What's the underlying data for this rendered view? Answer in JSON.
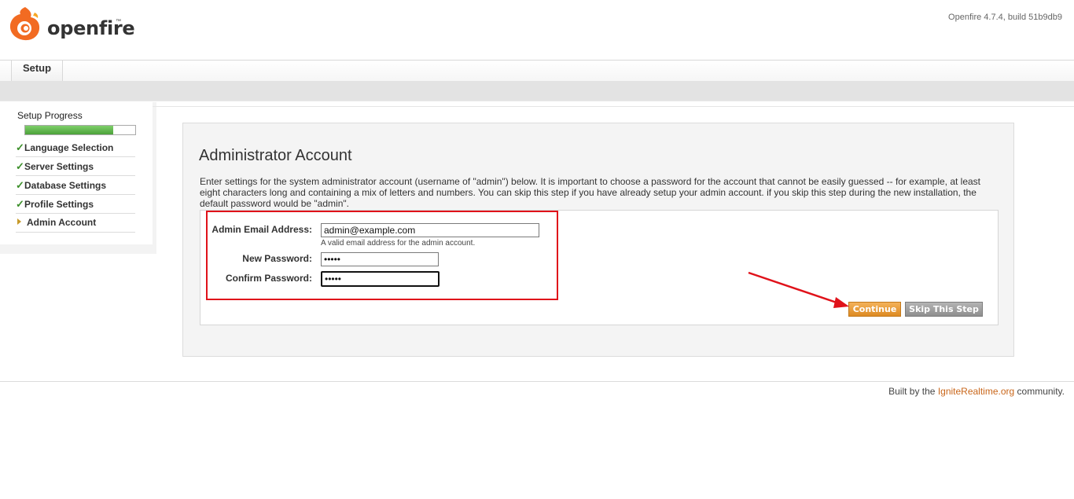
{
  "header": {
    "logo_text": "openfire",
    "logo_tm": "™",
    "version": "Openfire 4.7.4, build 51b9db9"
  },
  "tabs": [
    {
      "label": "Setup"
    }
  ],
  "sidebar": {
    "progress_label": "Setup Progress",
    "progress_fraction": 0.8,
    "steps": [
      {
        "label": "Language Selection",
        "status": "complete"
      },
      {
        "label": "Server Settings",
        "status": "complete"
      },
      {
        "label": "Database Settings",
        "status": "complete"
      },
      {
        "label": "Profile Settings",
        "status": "complete"
      },
      {
        "label": "Admin Account",
        "status": "current"
      }
    ]
  },
  "main": {
    "title": "Administrator Account",
    "description": "Enter settings for the system administrator account (username of \"admin\") below. It is important to choose a password for the account that cannot be easily guessed -- for example, at least eight characters long and containing a mix of letters and numbers. You can skip this step if you have already setup your admin account. if you skip this step during the new installation, the default password would be \"admin\".",
    "form": {
      "email_label": "Admin Email Address:",
      "email_value": "admin@example.com",
      "email_hint": "A valid email address for the admin account.",
      "new_password_label": "New Password:",
      "new_password_value": "•••••",
      "confirm_password_label": "Confirm Password:",
      "confirm_password_value": "•••••"
    },
    "buttons": {
      "continue": "Continue",
      "skip": "Skip This Step"
    }
  },
  "footer": {
    "prefix": "Built by the ",
    "link": "IgniteRealtime.org",
    "suffix": " community."
  },
  "colors": {
    "accent_orange": "#dd8a22",
    "progress_green": "#4ca23a",
    "annotation_red": "#e0121a"
  }
}
